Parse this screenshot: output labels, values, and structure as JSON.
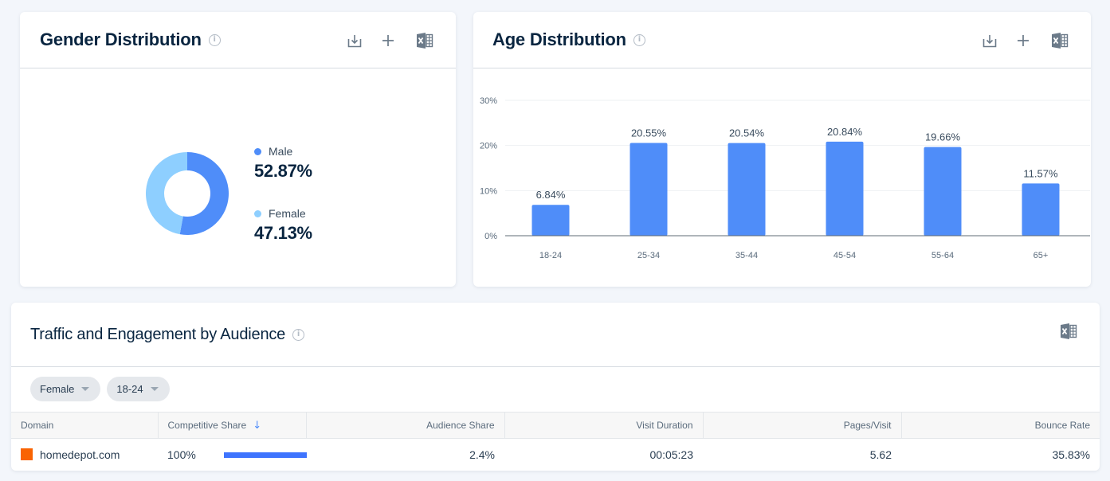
{
  "gender_card": {
    "title": "Gender Distribution",
    "actions": [
      "download-png",
      "add-to-dashboard",
      "export-excel"
    ],
    "legend": [
      {
        "label": "Male",
        "value": "52.87%",
        "color": "#4f8df9"
      },
      {
        "label": "Female",
        "value": "47.13%",
        "color": "#8ecfff"
      }
    ]
  },
  "age_card": {
    "title": "Age Distribution",
    "actions": [
      "download-png",
      "add-to-dashboard",
      "export-excel"
    ]
  },
  "chart_data": {
    "type": "bar",
    "title": "Age Distribution",
    "categories": [
      "18-24",
      "25-34",
      "35-44",
      "45-54",
      "55-64",
      "65+"
    ],
    "values": [
      6.84,
      20.55,
      20.54,
      20.84,
      19.66,
      11.57
    ],
    "value_labels": [
      "6.84%",
      "20.55%",
      "20.54%",
      "20.84%",
      "19.66%",
      "11.57%"
    ],
    "yticks": [
      "0%",
      "10%",
      "20%",
      "30%"
    ],
    "ylim": [
      0,
      30
    ],
    "xlabel": "",
    "ylabel": "",
    "grid": true,
    "bar_color": "#4f8df9"
  },
  "gender_chart_data": {
    "type": "pie",
    "labels": [
      "Male",
      "Female"
    ],
    "values": [
      52.87,
      47.13
    ],
    "colors": [
      "#4f8df9",
      "#8ecfff"
    ]
  },
  "traffic_card": {
    "title": "Traffic and Engagement by Audience",
    "filters": [
      {
        "label": "Female"
      },
      {
        "label": "18-24"
      }
    ],
    "columns": [
      "Domain",
      "Competitive Share",
      "Audience Share",
      "Visit Duration",
      "Pages/Visit",
      "Bounce Rate"
    ],
    "sort_indicator": "↓",
    "rows": [
      {
        "domain": "homedepot.com",
        "competitive_share": "100%",
        "competitive_share_fraction": 1.0,
        "audience_share": "2.4%",
        "visit_duration": "00:05:23",
        "pages_per_visit": "5.62",
        "bounce_rate": "35.83%"
      }
    ]
  },
  "icons": {
    "info": "i",
    "plus": "+",
    "favicon": "homedepot-logo"
  }
}
